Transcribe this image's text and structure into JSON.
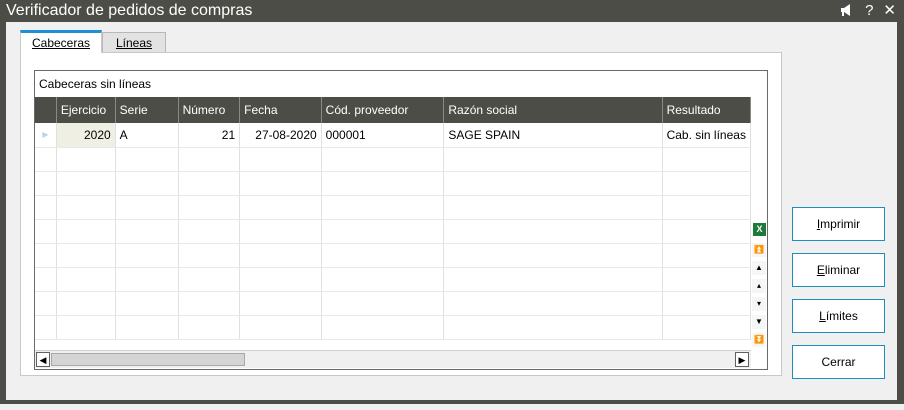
{
  "window": {
    "title": "Verificador de pedidos de compras",
    "icons": [
      "megaphone-icon",
      "help-icon",
      "close-icon"
    ],
    "help_glyph": "?",
    "close_glyph": "✕"
  },
  "tabs": [
    {
      "label": "Cabeceras",
      "active": true
    },
    {
      "label": "Líneas",
      "active": false
    }
  ],
  "grid": {
    "caption": "Cabeceras sin líneas",
    "columns": [
      "Ejercicio",
      "Serie",
      "Número",
      "Fecha",
      "Cód. proveedor",
      "Razón social",
      "Resultado"
    ],
    "rows": [
      [
        "2020",
        "A",
        "21",
        "27-08-2020",
        "000001",
        "SAGE SPAIN",
        "Cab. sin líneas"
      ]
    ],
    "row_indicator": "▶"
  },
  "buttons": {
    "imprimir": {
      "accel": "I",
      "rest": "mprimir"
    },
    "eliminar": {
      "accel": "E",
      "rest": "liminar"
    },
    "limites": {
      "accel": "L",
      "rest": "ímites"
    },
    "cerrar": "Cerrar"
  },
  "colors": {
    "titlebar": "#4d4d47",
    "accent": "#1e8cc0",
    "header": "#4d4d47"
  }
}
